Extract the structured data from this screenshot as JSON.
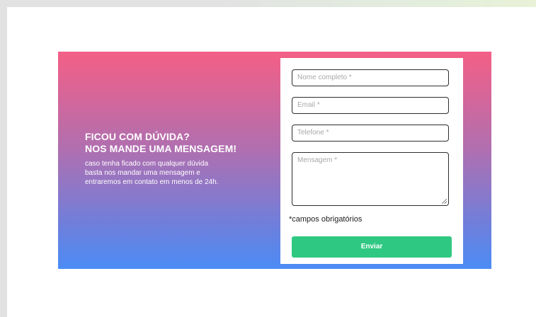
{
  "banner": {
    "heading_line1": "FICOU COM DÚVIDA?",
    "heading_line2": "NOS MANDE UMA MENSAGEM!",
    "description_line1": "caso tenha ficado com qualquer dúvida",
    "description_line2": "basta nos mandar uma mensagem e",
    "description_line3": "entraremos em contato em menos de 24h."
  },
  "form": {
    "name_placeholder": "Nome completo *",
    "email_placeholder": "Email *",
    "phone_placeholder": "Telefone *",
    "message_placeholder": "Mensagem *",
    "required_note": "*campos obrigatórios",
    "submit_label": "Enviar"
  },
  "colors": {
    "gradient_top": "#f45f86",
    "gradient_bottom": "#4b8cf5",
    "submit_button": "#2fc882"
  }
}
